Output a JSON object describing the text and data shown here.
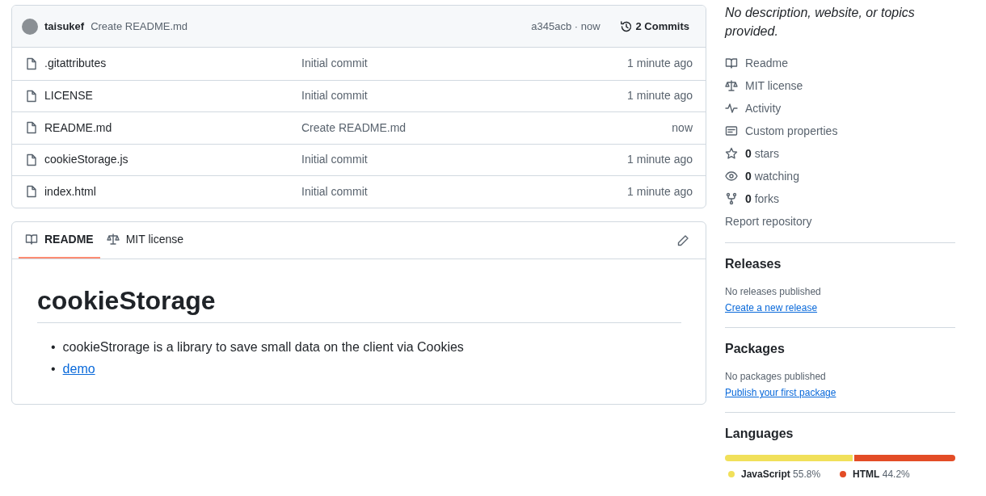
{
  "commit_bar": {
    "author": "taisukef",
    "message": "Create README.md",
    "hash_time": "a345acb · now",
    "commits": "2 Commits"
  },
  "files": [
    {
      "name": ".gitattributes",
      "message": "Initial commit",
      "time": "1 minute ago"
    },
    {
      "name": "LICENSE",
      "message": "Initial commit",
      "time": "1 minute ago"
    },
    {
      "name": "README.md",
      "message": "Create README.md",
      "time": "now"
    },
    {
      "name": "cookieStorage.js",
      "message": "Initial commit",
      "time": "1 minute ago"
    },
    {
      "name": "index.html",
      "message": "Initial commit",
      "time": "1 minute ago"
    }
  ],
  "readme_tabs": [
    {
      "label": "README",
      "kind": "book",
      "selected": true
    },
    {
      "label": "MIT license",
      "kind": "scale",
      "selected": false
    }
  ],
  "readme": {
    "heading": "cookieStorage",
    "bullets": [
      {
        "marker": "•",
        "text": "cookieStrorage is a library to save small data on the client via Cookies",
        "link": false
      },
      {
        "marker": "•",
        "text": "demo",
        "link": true
      }
    ]
  },
  "about": {
    "description": "No description, website, or topics provided.",
    "items": [
      {
        "kind": "book",
        "label": "Readme"
      },
      {
        "kind": "scale",
        "label": "MIT license"
      },
      {
        "kind": "pulse",
        "label": "Activity"
      },
      {
        "kind": "note",
        "label": "Custom properties"
      },
      {
        "kind": "star",
        "count": "0",
        "label": "stars"
      },
      {
        "kind": "eye",
        "count": "0",
        "label": "watching"
      },
      {
        "kind": "fork",
        "count": "0",
        "label": "forks"
      }
    ],
    "report": "Report repository"
  },
  "releases": {
    "title": "Releases",
    "note": "No releases published",
    "link": "Create a new release"
  },
  "packages": {
    "title": "Packages",
    "note": "No packages published",
    "link": "Publish your first package"
  },
  "languages": {
    "title": "Languages",
    "items": [
      {
        "name": "JavaScript",
        "percent": "55.8%",
        "color": "#f1e05a",
        "level": 0.558
      },
      {
        "name": "HTML",
        "percent": "44.2%",
        "color": "#e34c26",
        "level": 0.442
      }
    ]
  }
}
